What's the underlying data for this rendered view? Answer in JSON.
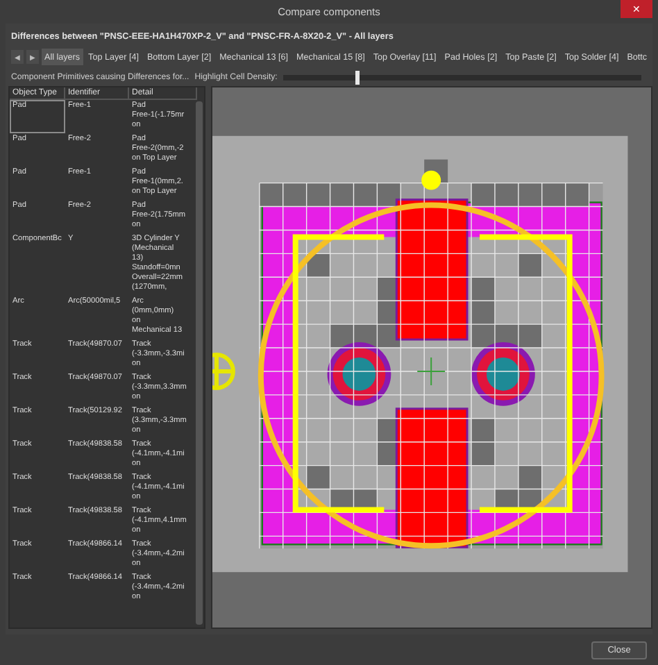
{
  "window": {
    "title": "Compare components",
    "close_glyph": "✕"
  },
  "header": "Differences between \"PNSC-EEE-HA1H470XP-2_V\" and \"PNSC-FR-A-8X20-2_V\" - All layers",
  "tab_arrows": [
    "◀",
    "▶"
  ],
  "tabs": [
    {
      "label": "All layers",
      "selected": true
    },
    {
      "label": "Top Layer [4]",
      "selected": false
    },
    {
      "label": "Bottom Layer [2]",
      "selected": false
    },
    {
      "label": "Mechanical 13 [6]",
      "selected": false
    },
    {
      "label": "Mechanical 15 [8]",
      "selected": false
    },
    {
      "label": "Top Overlay [11]",
      "selected": false
    },
    {
      "label": "Pad Holes [2]",
      "selected": false
    },
    {
      "label": "Top Paste [2]",
      "selected": false
    },
    {
      "label": "Top Solder [4]",
      "selected": false
    },
    {
      "label": "Bottc",
      "selected": false
    }
  ],
  "primitives_label": "Component Primitives causing Differences for...",
  "density": {
    "label": "Highlight Cell Density:",
    "level": 0.2
  },
  "table": {
    "columns": [
      "Object Type",
      "Identifier",
      "Detail"
    ],
    "rows": [
      {
        "type": "Pad",
        "identifier": "Free-1",
        "detail": [
          "Pad",
          "Free-1(-1.75mr",
          "on"
        ],
        "selected": true
      },
      {
        "type": "Pad",
        "identifier": "Free-2",
        "detail": [
          "Pad",
          "Free-2(0mm,-2",
          "on Top Layer"
        ],
        "selected": false
      },
      {
        "type": "Pad",
        "identifier": "Free-1",
        "detail": [
          "Pad",
          "Free-1(0mm,2.",
          "on Top Layer"
        ],
        "selected": false
      },
      {
        "type": "Pad",
        "identifier": "Free-2",
        "detail": [
          "Pad",
          "Free-2(1.75mm",
          "on"
        ],
        "selected": false
      },
      {
        "type": "ComponentBc",
        "identifier": "Y",
        "detail": [
          "3D Cylinder Y",
          "(Mechanical",
          "13)",
          "Standoff=0mn",
          "Overall=22mm",
          "(1270mm,"
        ],
        "selected": false
      },
      {
        "type": "Arc",
        "identifier": "Arc(50000mil,5",
        "detail": [
          "Arc",
          "(0mm,0mm)",
          "on",
          "Mechanical 13"
        ],
        "selected": false
      },
      {
        "type": "Track",
        "identifier": "Track(49870.07",
        "detail": [
          "Track",
          "(-3.3mm,-3.3mi",
          "on"
        ],
        "selected": false
      },
      {
        "type": "Track",
        "identifier": "Track(49870.07",
        "detail": [
          "Track",
          "(-3.3mm,3.3mm",
          "on"
        ],
        "selected": false
      },
      {
        "type": "Track",
        "identifier": "Track(50129.92",
        "detail": [
          "Track",
          "(3.3mm,-3.3mm",
          "on"
        ],
        "selected": false
      },
      {
        "type": "Track",
        "identifier": "Track(49838.58",
        "detail": [
          "Track",
          "(-4.1mm,-4.1mi",
          "on"
        ],
        "selected": false
      },
      {
        "type": "Track",
        "identifier": "Track(49838.58",
        "detail": [
          "Track",
          "(-4.1mm,-4.1mi",
          "on"
        ],
        "selected": false
      },
      {
        "type": "Track",
        "identifier": "Track(49838.58",
        "detail": [
          "Track",
          "(-4.1mm,4.1mm",
          "on"
        ],
        "selected": false
      },
      {
        "type": "Track",
        "identifier": "Track(49866.14",
        "detail": [
          "Track",
          "(-3.4mm,-4.2mi",
          "on"
        ],
        "selected": false
      },
      {
        "type": "Track",
        "identifier": "Track(49866.14",
        "detail": [
          "Track",
          "(-3.4mm,-4.2mi",
          "on"
        ],
        "selected": false
      }
    ]
  },
  "close_button": "Close"
}
